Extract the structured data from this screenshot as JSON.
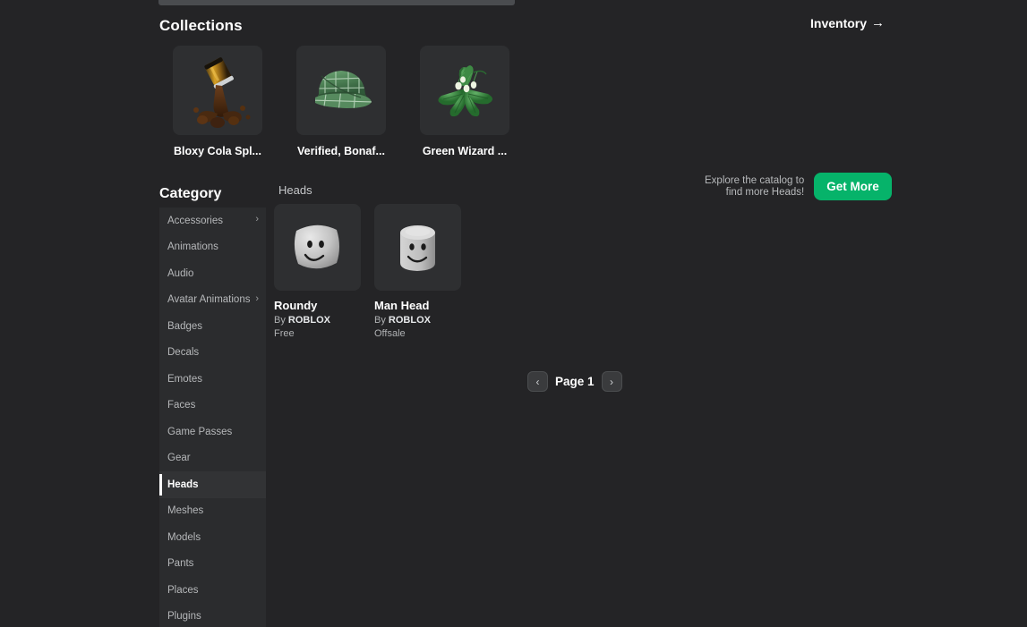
{
  "theme": {
    "page_bg": "#242426",
    "panel_bg": "#2b2c2e",
    "thumb_bg": "#2e2f31",
    "accent_green": "#06b36a",
    "text_primary": "#ffffff",
    "text_muted": "#b0b2b4"
  },
  "header": {
    "collections_title": "Collections",
    "inventory_link": "Inventory",
    "inventory_arrow": "arrow-right-icon"
  },
  "collections": [
    {
      "label": "Bloxy Cola Spl...",
      "thumb": "bloxy-cola-splash-thumbnail"
    },
    {
      "label": "Verified, Bonaf...",
      "thumb": "green-plaid-cap-thumbnail"
    },
    {
      "label": "Green Wizard ...",
      "thumb": "green-wizard-plant-thumbnail"
    }
  ],
  "category": {
    "title": "Category",
    "items": [
      {
        "label": "Accessories",
        "expandable": true,
        "active": false
      },
      {
        "label": "Animations",
        "expandable": false,
        "active": false
      },
      {
        "label": "Audio",
        "expandable": false,
        "active": false
      },
      {
        "label": "Avatar Animations",
        "expandable": true,
        "active": false
      },
      {
        "label": "Badges",
        "expandable": false,
        "active": false
      },
      {
        "label": "Decals",
        "expandable": false,
        "active": false
      },
      {
        "label": "Emotes",
        "expandable": false,
        "active": false
      },
      {
        "label": "Faces",
        "expandable": false,
        "active": false
      },
      {
        "label": "Game Passes",
        "expandable": false,
        "active": false
      },
      {
        "label": "Gear",
        "expandable": false,
        "active": false
      },
      {
        "label": "Heads",
        "expandable": false,
        "active": true
      },
      {
        "label": "Meshes",
        "expandable": false,
        "active": false
      },
      {
        "label": "Models",
        "expandable": false,
        "active": false
      },
      {
        "label": "Pants",
        "expandable": false,
        "active": false
      },
      {
        "label": "Places",
        "expandable": false,
        "active": false
      },
      {
        "label": "Plugins",
        "expandable": false,
        "active": false
      }
    ],
    "chevron_icon": "chevron-right-icon"
  },
  "main": {
    "section_heading": "Heads",
    "promo_text": "Explore the catalog to\nfind more Heads!",
    "get_more_label": "Get More",
    "items": [
      {
        "name": "Roundy",
        "creator_prefix": "By",
        "creator": "ROBLOX",
        "price": "Free",
        "thumb": "roundy-head-thumbnail"
      },
      {
        "name": "Man Head",
        "creator_prefix": "By",
        "creator": "ROBLOX",
        "price": "Offsale",
        "thumb": "man-head-thumbnail"
      }
    ]
  },
  "pagination": {
    "prev_icon": "chevron-left-icon",
    "next_icon": "chevron-right-icon",
    "page_label": "Page 1"
  }
}
